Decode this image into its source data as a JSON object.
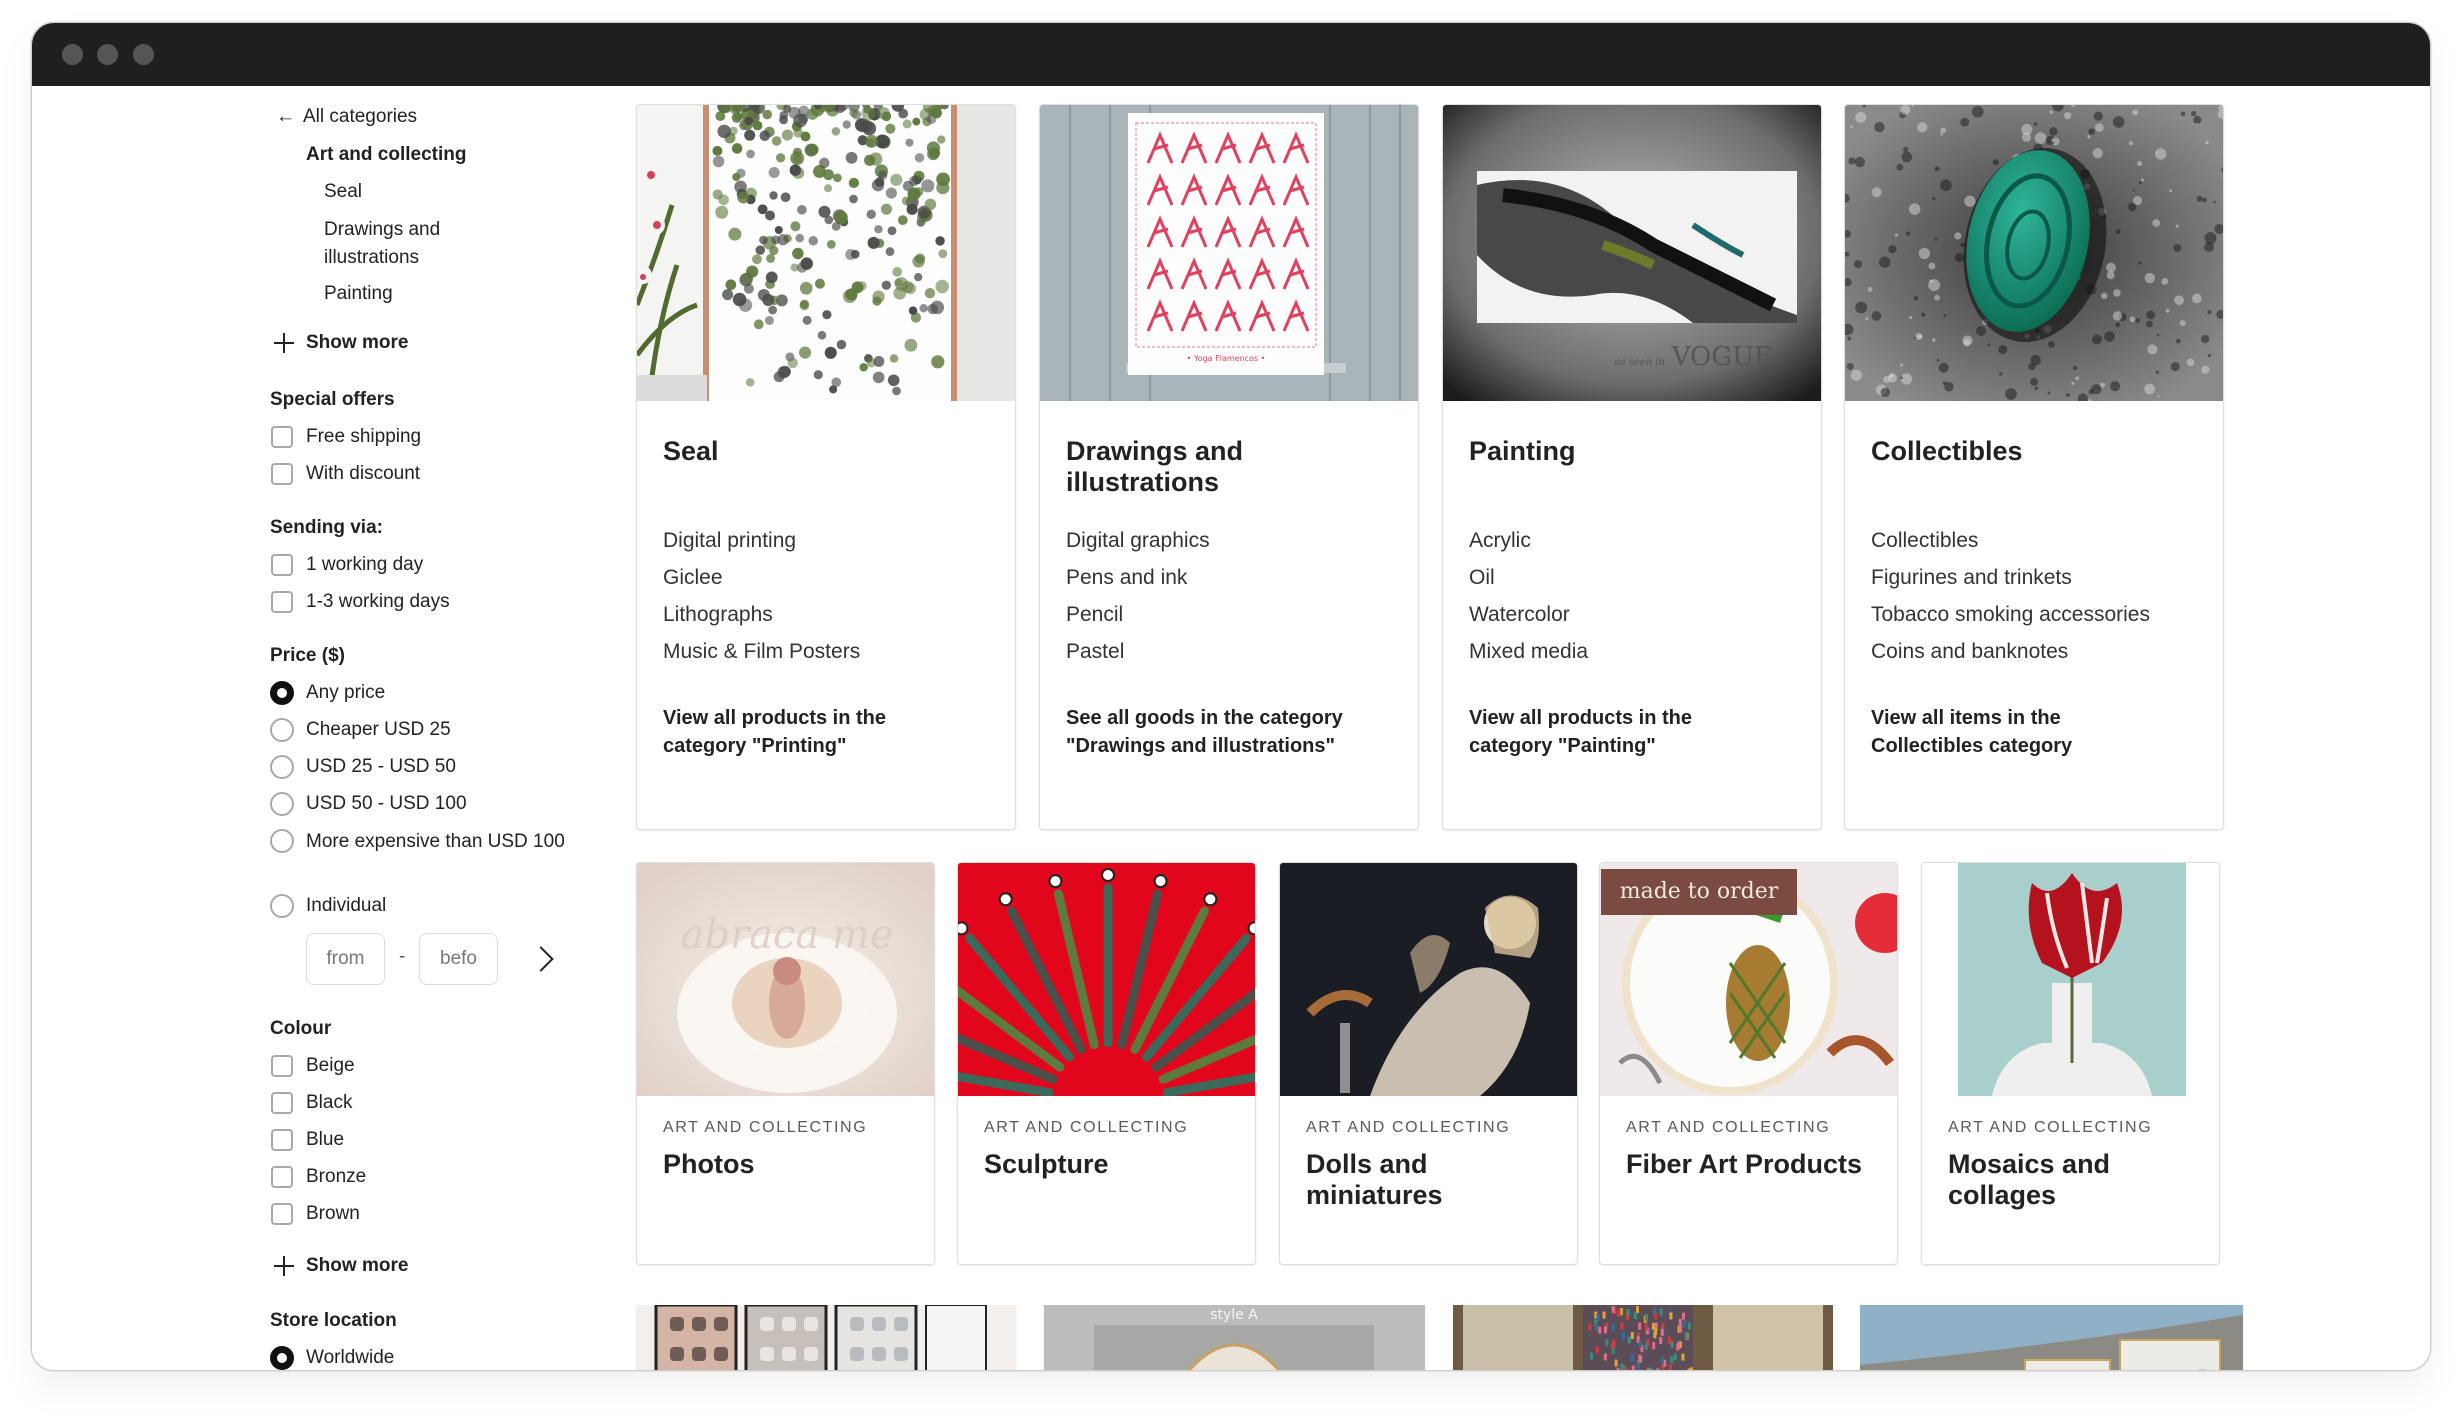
{
  "window": {
    "controls": [
      "close",
      "minimize",
      "maximize"
    ]
  },
  "sidebar": {
    "back_link": {
      "icon": "arrow-left-icon",
      "label": "All categories"
    },
    "current_category": "Art and collecting",
    "subcategories": [
      "Seal",
      "Drawings and illustrations",
      "Painting"
    ],
    "show_more_categories": "Show more",
    "special_offers": {
      "heading": "Special offers",
      "options": [
        {
          "label": "Free shipping",
          "checked": false
        },
        {
          "label": "With discount",
          "checked": false
        }
      ]
    },
    "sending_via": {
      "heading": "Sending via:",
      "options": [
        {
          "label": "1 working day",
          "checked": false
        },
        {
          "label": "1-3 working days",
          "checked": false
        }
      ]
    },
    "price": {
      "heading": "Price ($)",
      "options": [
        {
          "label": "Any price",
          "selected": true
        },
        {
          "label": "Cheaper USD 25",
          "selected": false
        },
        {
          "label": "USD 25 - USD 50",
          "selected": false
        },
        {
          "label": "USD 50 - USD 100",
          "selected": false
        },
        {
          "label": "More expensive than USD 100",
          "selected": false
        },
        {
          "label": "Individual",
          "selected": false
        }
      ],
      "from_placeholder": "from",
      "from_value": "",
      "to_placeholder": "befo",
      "to_value": "",
      "separator": "-",
      "submit_icon": "chevron-right-icon"
    },
    "colour": {
      "heading": "Colour",
      "options": [
        {
          "label": "Beige",
          "checked": false
        },
        {
          "label": "Black",
          "checked": false
        },
        {
          "label": "Blue",
          "checked": false
        },
        {
          "label": "Bronze",
          "checked": false
        },
        {
          "label": "Brown",
          "checked": false
        }
      ],
      "show_more": "Show more"
    },
    "store_location": {
      "heading": "Store location",
      "options": [
        {
          "label": "Worldwide",
          "selected": true
        }
      ]
    }
  },
  "main": {
    "featured_categories": [
      {
        "title": "Seal",
        "image": "hanging-plant-print",
        "subitems": [
          "Digital printing",
          "Giclee",
          "Lithographs",
          "Music & Film Posters"
        ],
        "link": "View all products in the category \"Printing\""
      },
      {
        "title": "Drawings and illustrations",
        "image": "yoga-poses-poster",
        "subitems": [
          "Digital graphics",
          "Pens and ink",
          "Pencil",
          "Pastel"
        ],
        "link": "See all goods in the category \"Drawings and illustrations\""
      },
      {
        "title": "Painting",
        "image": "abstract-painting",
        "image_caption": "as seen in VOGUE",
        "subitems": [
          "Acrylic",
          "Oil",
          "Watercolor",
          "Mixed media"
        ],
        "link": "View all products in the category \"Painting\""
      },
      {
        "title": "Collectibles",
        "image": "green-wax-seal",
        "subitems": [
          "Collectibles",
          "Figurines and trinkets",
          "Tobacco smoking accessories",
          "Coins and banknotes"
        ],
        "link": "View all items in the Collectibles category"
      }
    ],
    "subcategory_cards": [
      {
        "category": "ART AND COLLECTING",
        "title": "Photos",
        "image": "newborn-in-flower",
        "image_text": "abraca me"
      },
      {
        "category": "ART AND COLLECTING",
        "title": "Sculpture",
        "image": "daggers-on-red"
      },
      {
        "category": "ART AND COLLECTING",
        "title": "Dolls and miniatures",
        "image": "art-doll"
      },
      {
        "category": "ART AND COLLECTING",
        "title": "Fiber Art Products",
        "image": "pineapple-embroidery",
        "badge": "made to order"
      },
      {
        "category": "ART AND COLLECTING",
        "title": "Mosaics and collages",
        "image": "tulip-figure"
      }
    ],
    "more_cards": [
      {
        "image": "phone-icon-prints"
      },
      {
        "image": "arched-wall-art",
        "image_text": "style A"
      },
      {
        "image": "colorful-wall-hanging"
      },
      {
        "image": "landscape-triptych"
      }
    ]
  }
}
